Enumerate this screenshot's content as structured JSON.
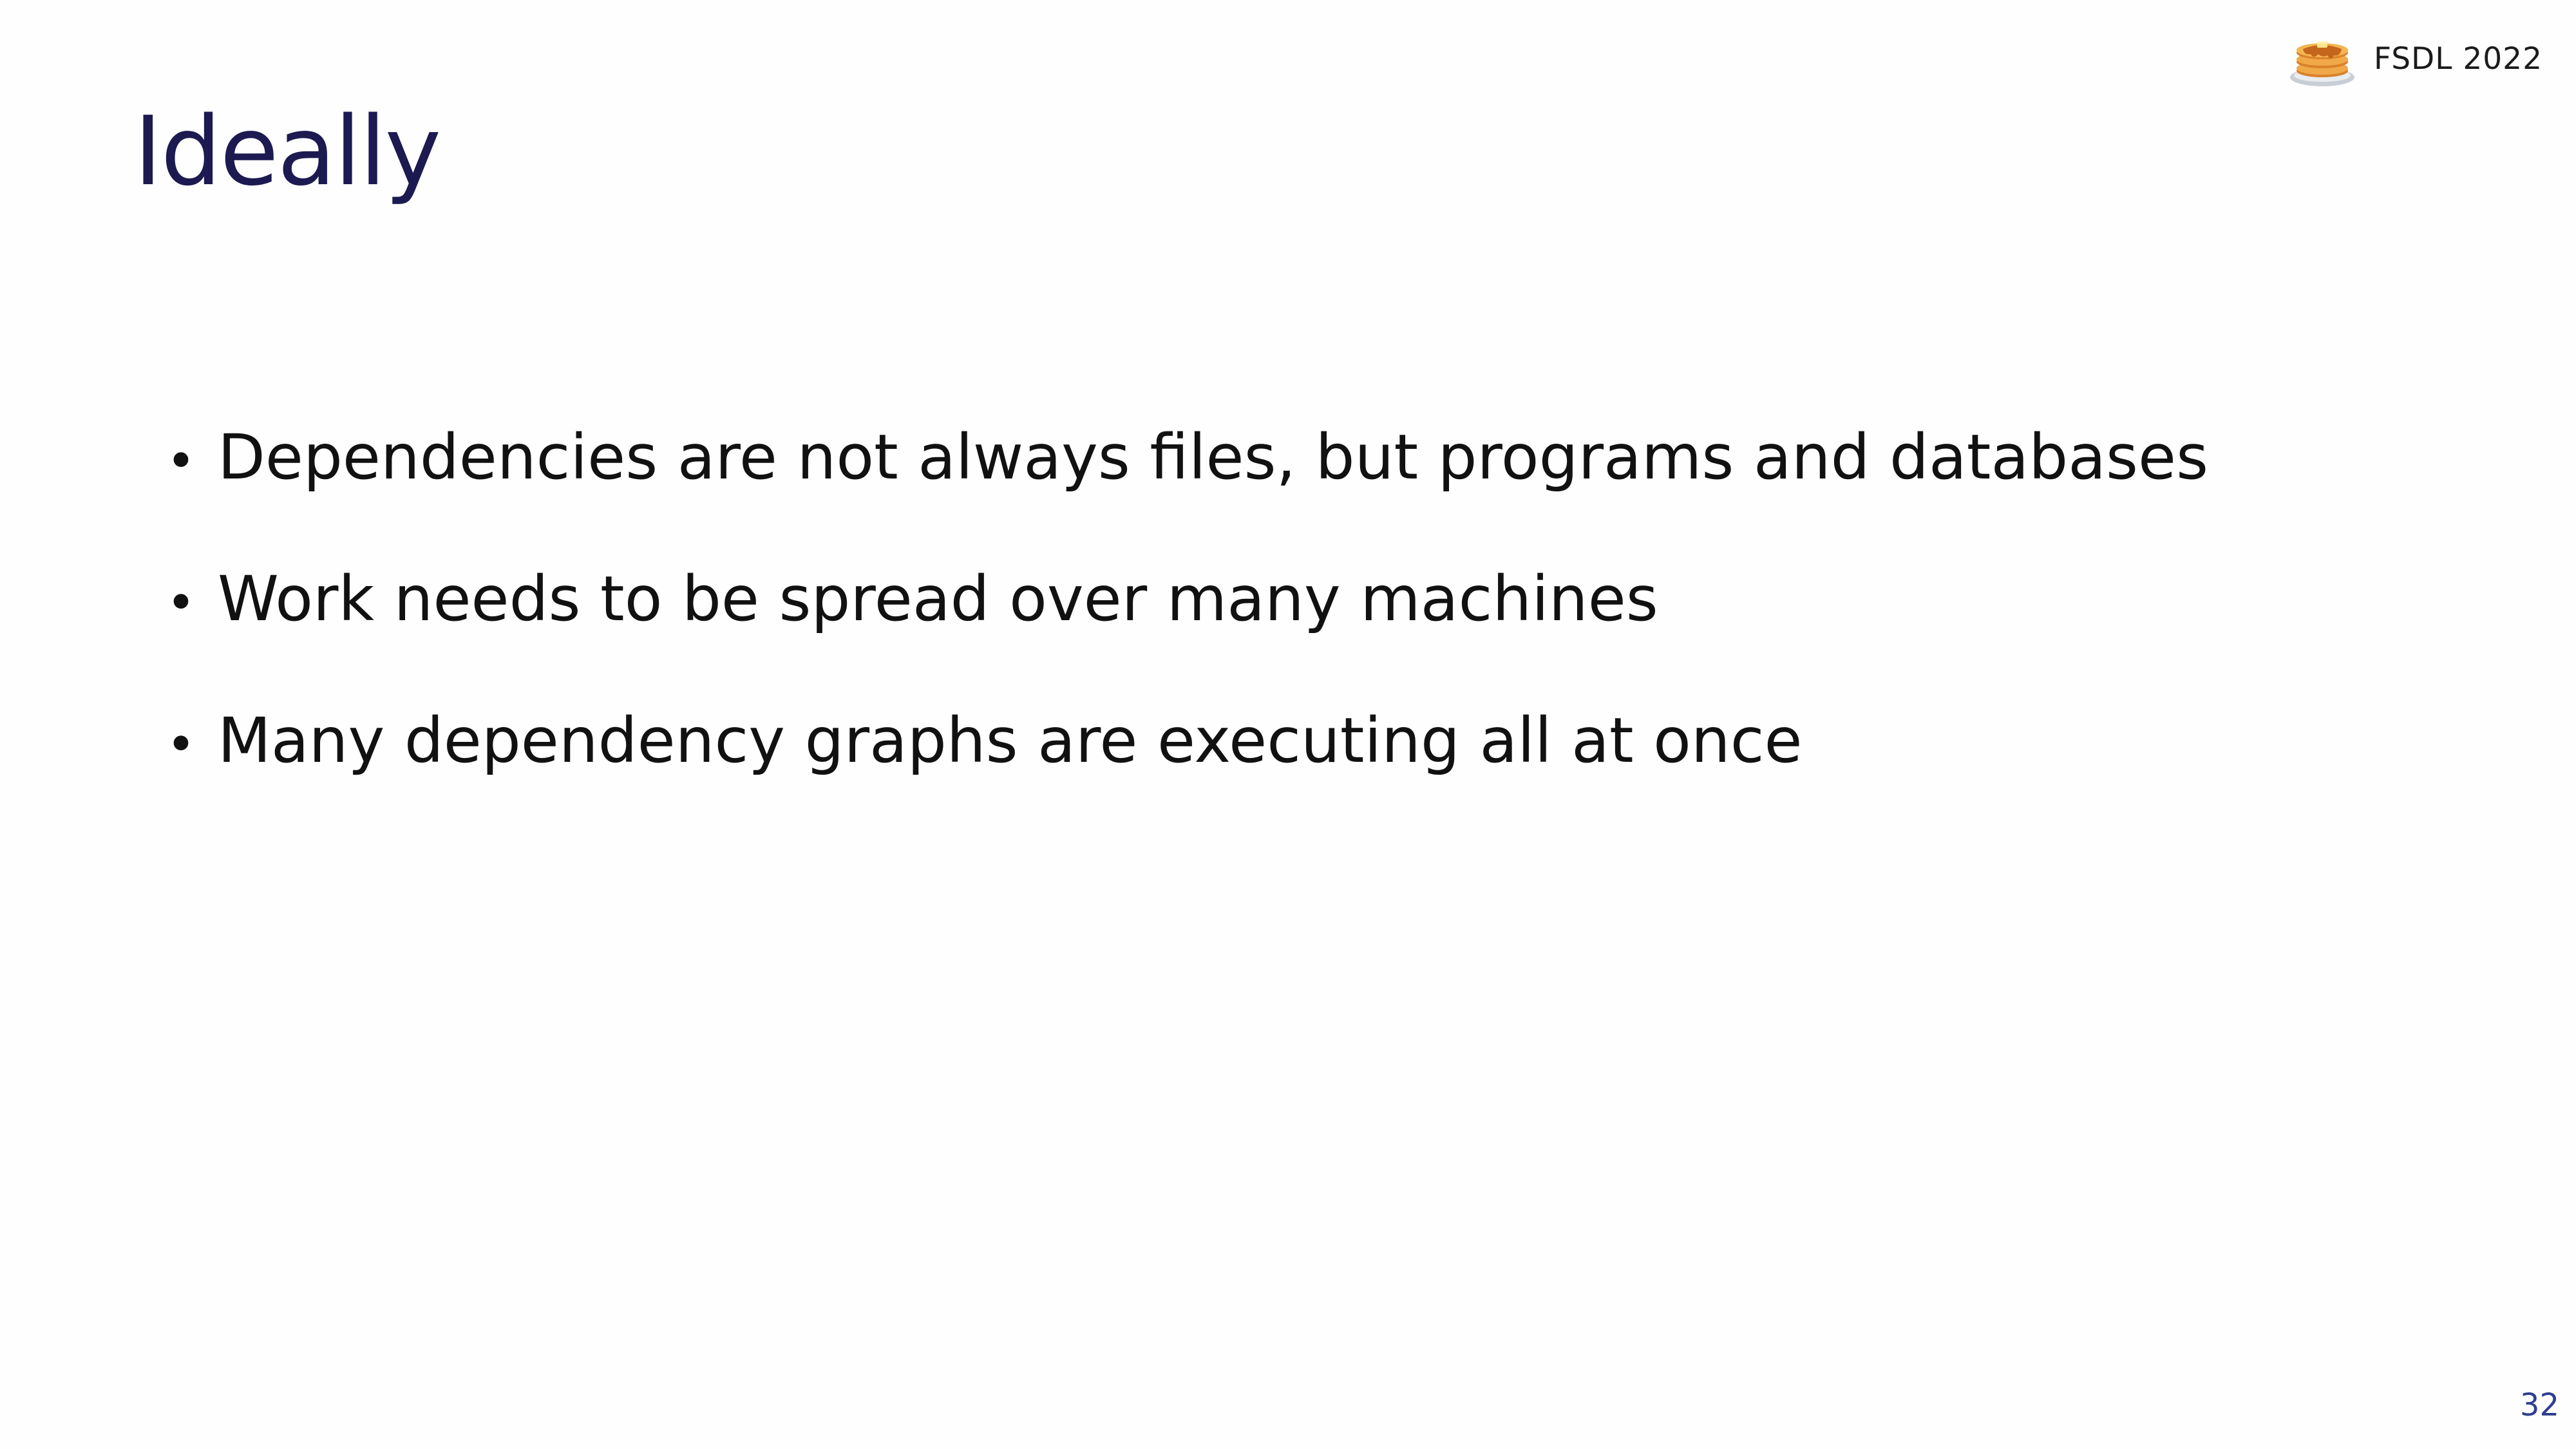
{
  "header": {
    "brand_icon": "pancake-stack-icon",
    "brand_label": "FSDL 2022"
  },
  "slide": {
    "title": "Ideally",
    "bullets": [
      {
        "text": "Dependencies are not always files, but programs and databases"
      },
      {
        "text": "Work needs to be spread over many machines"
      },
      {
        "text": "Many dependency graphs are executing all at once"
      }
    ],
    "bullet_glyph": "•",
    "page_number": "32"
  },
  "colors": {
    "title": "#1c1a50",
    "body_text": "#111111",
    "page_number": "#2f3f8f",
    "background": "#fefefe"
  }
}
